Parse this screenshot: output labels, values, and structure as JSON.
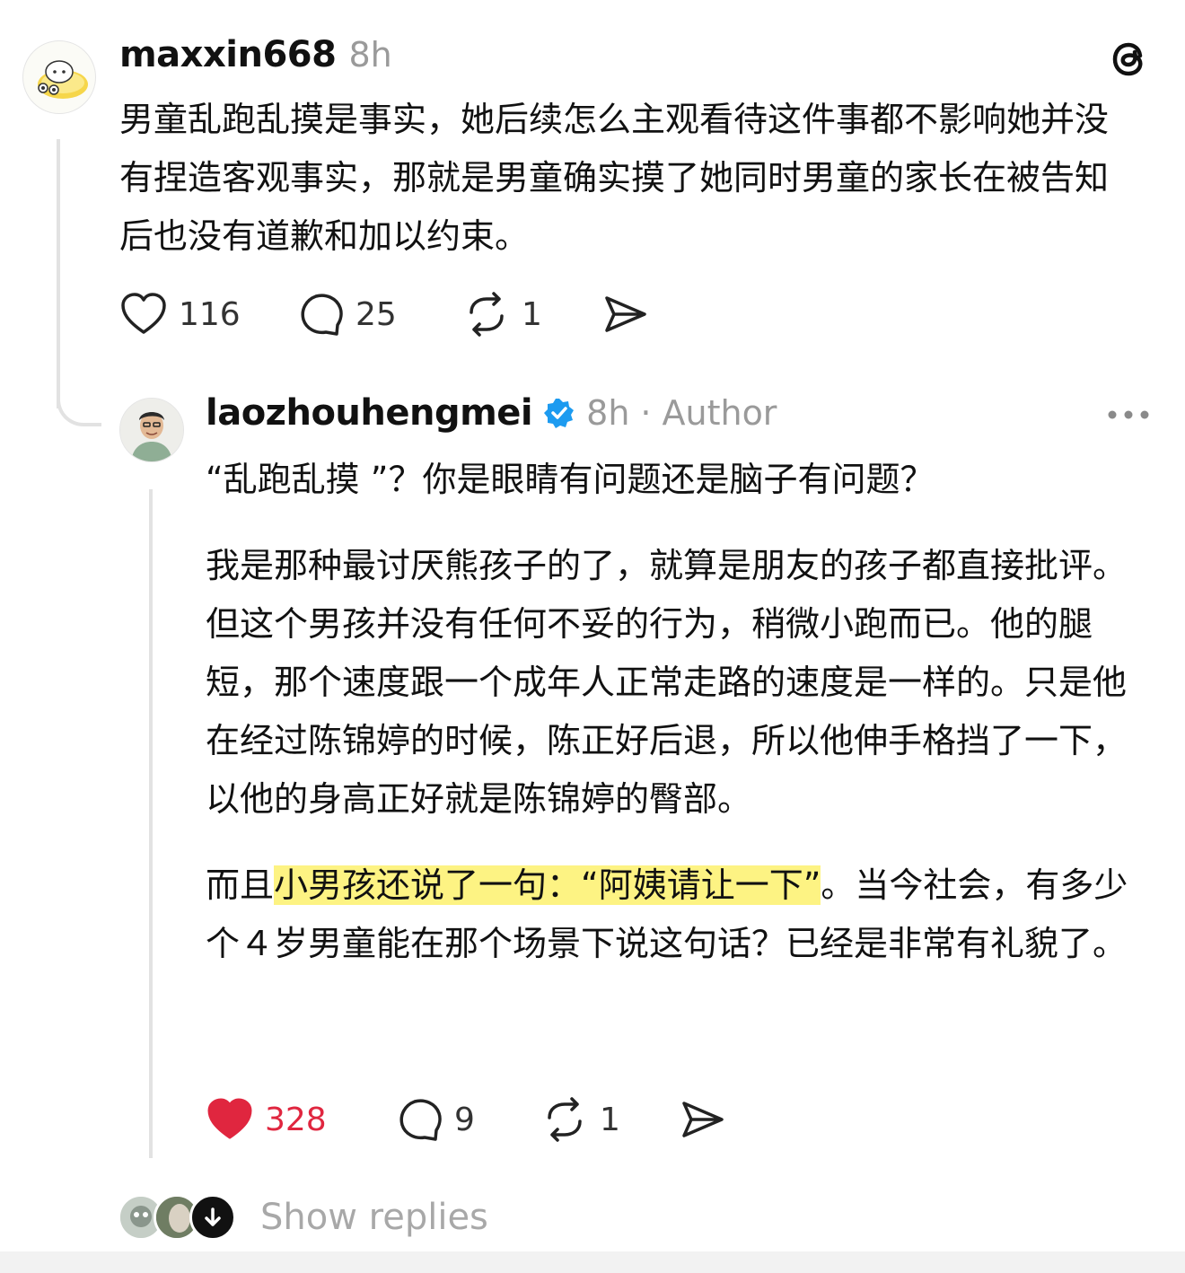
{
  "comment": {
    "username": "maxxin668",
    "time": "8h",
    "text": "男童乱跑乱摸是事实，她后续怎么主观看待这件事都不影响她并没有捏造客观事实，那就是男童确实摸了她同时男童的家长在被告知后也没有道歉和加以约束。",
    "likes": "116",
    "replies": "25",
    "reposts": "1"
  },
  "reply": {
    "username": "laozhouhengmei",
    "time": "8h",
    "separator": "·",
    "author_tag": "Author",
    "para1": "“乱跑乱摸 ”？你是眼睛有问题还是脑子有问题？",
    "para2": "我是那种最讨厌熊孩子的了，就算是朋友的孩子都直接批评。但这个男孩并没有任何不妥的行为，稍微小跑而已。他的腿短，那个速度跟一个成年人正常走路的速度是一样的。只是他在经过陈锦婷的时候，陈正好后退，所以他伸手格挡了一下，以他的身高正好就是陈锦婷的臀部。",
    "para3_before": "而且",
    "para3_highlight": "小男孩还说了一句：“阿姨请让一下”",
    "para3_after": "。当今社会，有多少个４岁男童能在那个场景下说这句话？已经是非常有礼貌了。",
    "likes": "328",
    "replies": "9",
    "reposts": "1"
  },
  "footer": {
    "show_replies": "Show replies"
  },
  "colors": {
    "like_active": "#e0263f",
    "verified": "#1d9bf0",
    "highlight": "#fdf383"
  }
}
